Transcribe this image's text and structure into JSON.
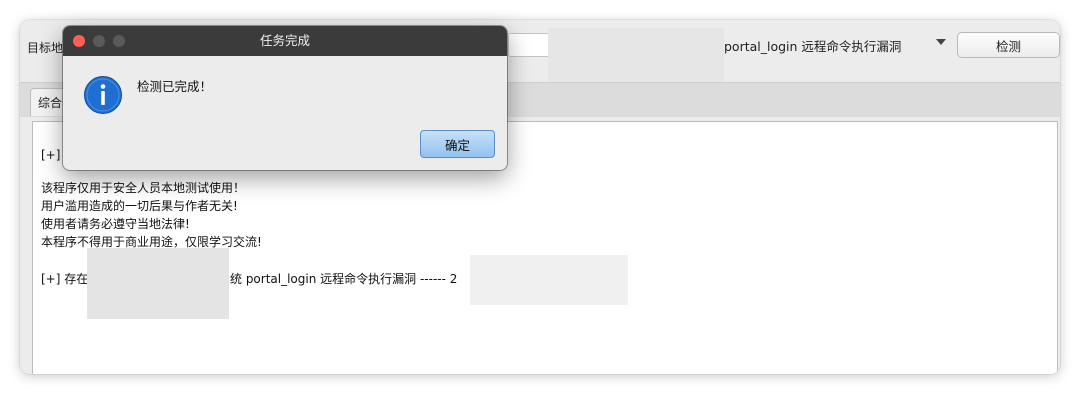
{
  "main_window": {
    "target_label": "目标地",
    "vuln_select_value": "portal_login 远程命令执行漏洞",
    "detect_button_label": "检测",
    "tabs": [
      {
        "label": "综合"
      }
    ],
    "output": {
      "line1": "[+] ",
      "line2": "该程序仅用于安全人员本地测试使用！",
      "line3": "用户滥用造成的一切后果与作者无关!",
      "line4": "使用者请务必遵守当地法律!",
      "line5": "本程序不得用于商业用途，仅限学习交流!",
      "line6_start": "[+] 存在",
      "line6_rest": "统 portal_login 远程命令执行漏洞 ------ 2"
    }
  },
  "dialog": {
    "title": "任务完成",
    "message": "检测已完成！",
    "ok_label": "确定",
    "icon": "info-icon"
  },
  "colors": {
    "dialog_titlebar": "#3b3b3b",
    "close_button": "#ff5f57",
    "ok_button": "#93c2ef",
    "info_icon": "#1f6fd0"
  }
}
